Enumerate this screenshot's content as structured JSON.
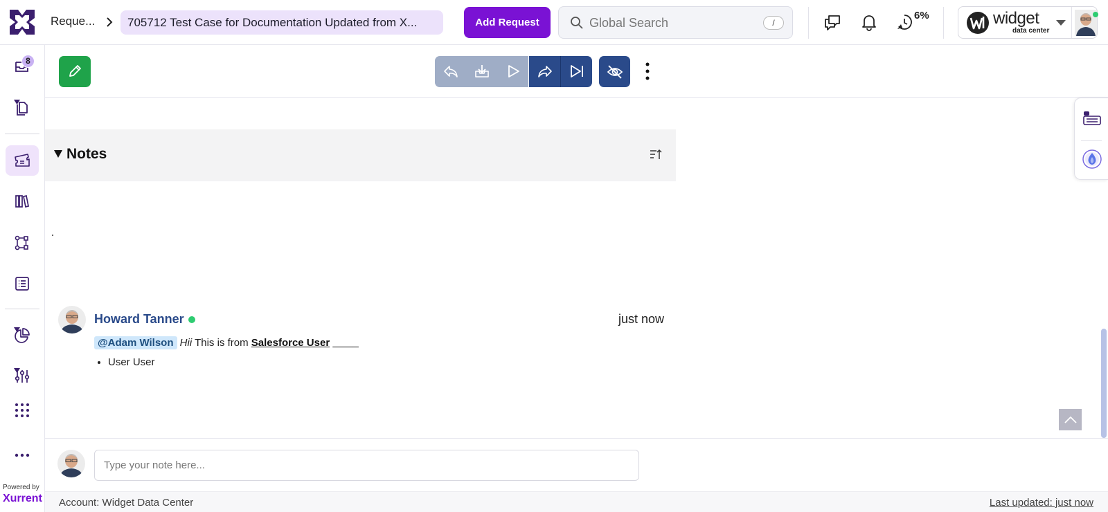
{
  "header": {
    "breadcrumb_root": "Reque...",
    "breadcrumb_current": "705712  Test Case for Documentation Updated from X...",
    "add_request_label": "Add Request",
    "search_placeholder": "Global Search",
    "search_shortcut": "/",
    "timer_percent": "6%",
    "brand_name": "widget",
    "brand_subtitle": "data center",
    "icons": [
      "chat-icon",
      "bell-icon",
      "timer-icon",
      "chevron-right-icon",
      "search-icon"
    ]
  },
  "sidebar": {
    "inbox_badge": "8",
    "items": [
      "inbox",
      "documents",
      "requests",
      "library",
      "workflows",
      "forms",
      "analytics",
      "settings",
      "apps",
      "more"
    ],
    "powered_by": "Powered by",
    "vendor": "Xurrent"
  },
  "toolbar": {
    "buttons": [
      "edit",
      "reply",
      "download",
      "play",
      "forward",
      "skip-to-end",
      "hide",
      "more"
    ]
  },
  "notes": {
    "title": "Notes",
    "entries": [
      {
        "author": "Howard Tanner",
        "time": "just now",
        "mention": "@Adam Wilson",
        "italic": "Hii",
        "text": "This is from",
        "link": "Salesforce User",
        "trailing": "__ __",
        "bullets": [
          "User User"
        ]
      }
    ]
  },
  "composer": {
    "placeholder": "Type your note here..."
  },
  "footer": {
    "account": "Account: Widget Data Center",
    "last_updated": "Last updated: just now"
  },
  "colors": {
    "brand_purple": "#7a12d4",
    "navy": "#2a4a8a",
    "edit_green": "#1fa34a",
    "online_green": "#2ecc71"
  }
}
